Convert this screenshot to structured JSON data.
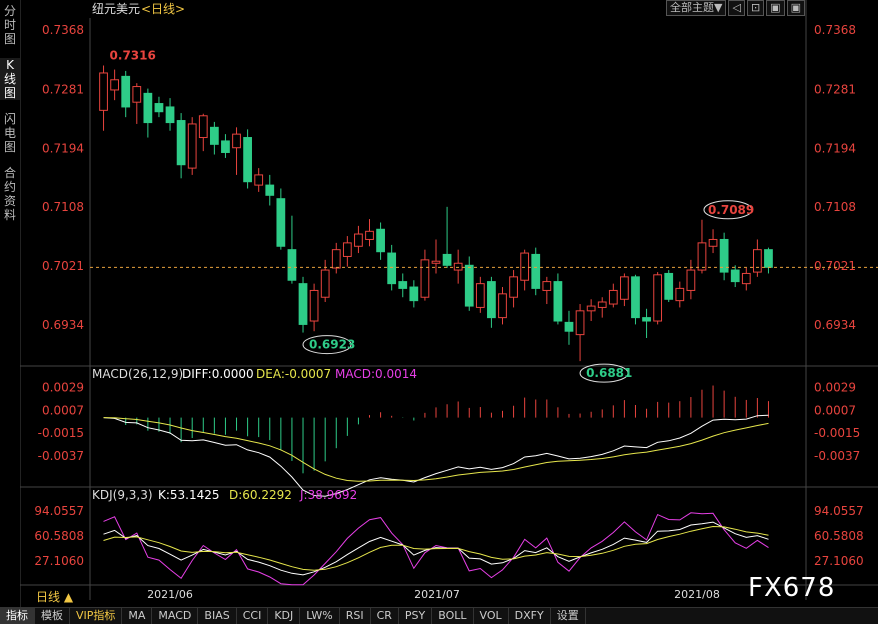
{
  "left_tabs": [
    {
      "label": "分时图",
      "active": false
    },
    {
      "label": "K线图",
      "active": true
    },
    {
      "label": "闪电图",
      "active": false
    },
    {
      "label": "合约资料",
      "active": false
    }
  ],
  "header": {
    "symbol": "纽元美元",
    "period_tag": "<日线>"
  },
  "top_controls": {
    "theme_label": "全部主题▼",
    "buttons": [
      "◁",
      "⊡",
      "▣",
      "▣"
    ]
  },
  "colors": {
    "up": "#e8443e",
    "down": "#2ecc88",
    "axis_text": "#e8443e",
    "grid": "#333",
    "white_line": "#ffffff",
    "yellow_line": "#e6e64c",
    "magenta_line": "#e63fe6"
  },
  "chart_data": [
    {
      "type": "candlestick",
      "title": "纽元美元<日线>",
      "y_ticks": [
        "0.7368",
        "0.7281",
        "0.7194",
        "0.7108",
        "0.7021",
        "0.6934"
      ],
      "ylim": [
        0.689,
        0.738
      ],
      "current_price": 0.7019,
      "annotations": [
        {
          "text": "0.7316",
          "value": 0.7316
        },
        {
          "text": "0.6923",
          "value": 0.6923
        },
        {
          "text": "0.6881",
          "value": 0.6881
        },
        {
          "text": "0.7089",
          "value": 0.7089
        }
      ],
      "x_labels": [
        "2021/06",
        "2021/07",
        "2021/08"
      ],
      "candles": [
        {
          "o": 0.725,
          "h": 0.7316,
          "l": 0.722,
          "c": 0.7305
        },
        {
          "o": 0.728,
          "h": 0.731,
          "l": 0.7265,
          "c": 0.7295
        },
        {
          "o": 0.73,
          "h": 0.7308,
          "l": 0.724,
          "c": 0.7255
        },
        {
          "o": 0.7262,
          "h": 0.729,
          "l": 0.723,
          "c": 0.7285
        },
        {
          "o": 0.7275,
          "h": 0.7282,
          "l": 0.721,
          "c": 0.7232
        },
        {
          "o": 0.726,
          "h": 0.727,
          "l": 0.724,
          "c": 0.7248
        },
        {
          "o": 0.7255,
          "h": 0.7268,
          "l": 0.722,
          "c": 0.7232
        },
        {
          "o": 0.7235,
          "h": 0.7246,
          "l": 0.715,
          "c": 0.717
        },
        {
          "o": 0.7165,
          "h": 0.724,
          "l": 0.7155,
          "c": 0.723
        },
        {
          "o": 0.721,
          "h": 0.7245,
          "l": 0.719,
          "c": 0.7242
        },
        {
          "o": 0.7225,
          "h": 0.7233,
          "l": 0.7185,
          "c": 0.72
        },
        {
          "o": 0.7205,
          "h": 0.7215,
          "l": 0.718,
          "c": 0.7188
        },
        {
          "o": 0.7195,
          "h": 0.7225,
          "l": 0.7155,
          "c": 0.7215
        },
        {
          "o": 0.721,
          "h": 0.7222,
          "l": 0.7135,
          "c": 0.7145
        },
        {
          "o": 0.714,
          "h": 0.7165,
          "l": 0.713,
          "c": 0.7155
        },
        {
          "o": 0.714,
          "h": 0.7155,
          "l": 0.711,
          "c": 0.7125
        },
        {
          "o": 0.712,
          "h": 0.7135,
          "l": 0.7045,
          "c": 0.705
        },
        {
          "o": 0.7045,
          "h": 0.7095,
          "l": 0.6995,
          "c": 0.7
        },
        {
          "o": 0.6995,
          "h": 0.7005,
          "l": 0.6923,
          "c": 0.6935
        },
        {
          "o": 0.694,
          "h": 0.6995,
          "l": 0.6925,
          "c": 0.6985
        },
        {
          "o": 0.6975,
          "h": 0.703,
          "l": 0.6968,
          "c": 0.7015
        },
        {
          "o": 0.7018,
          "h": 0.7055,
          "l": 0.701,
          "c": 0.7045
        },
        {
          "o": 0.7035,
          "h": 0.7065,
          "l": 0.702,
          "c": 0.7055
        },
        {
          "o": 0.705,
          "h": 0.708,
          "l": 0.704,
          "c": 0.7068
        },
        {
          "o": 0.706,
          "h": 0.709,
          "l": 0.705,
          "c": 0.7072
        },
        {
          "o": 0.7075,
          "h": 0.7085,
          "l": 0.703,
          "c": 0.7042
        },
        {
          "o": 0.704,
          "h": 0.7052,
          "l": 0.6985,
          "c": 0.6995
        },
        {
          "o": 0.6998,
          "h": 0.701,
          "l": 0.6975,
          "c": 0.6988
        },
        {
          "o": 0.699,
          "h": 0.7,
          "l": 0.696,
          "c": 0.697
        },
        {
          "o": 0.6975,
          "h": 0.7045,
          "l": 0.697,
          "c": 0.703
        },
        {
          "o": 0.7025,
          "h": 0.706,
          "l": 0.701,
          "c": 0.7028
        },
        {
          "o": 0.7038,
          "h": 0.7108,
          "l": 0.7018,
          "c": 0.7022
        },
        {
          "o": 0.7015,
          "h": 0.7045,
          "l": 0.6995,
          "c": 0.7025
        },
        {
          "o": 0.7022,
          "h": 0.7035,
          "l": 0.6955,
          "c": 0.6962
        },
        {
          "o": 0.696,
          "h": 0.7005,
          "l": 0.6952,
          "c": 0.6995
        },
        {
          "o": 0.6998,
          "h": 0.7005,
          "l": 0.693,
          "c": 0.6945
        },
        {
          "o": 0.6945,
          "h": 0.699,
          "l": 0.6935,
          "c": 0.698
        },
        {
          "o": 0.6975,
          "h": 0.7015,
          "l": 0.696,
          "c": 0.7005
        },
        {
          "o": 0.7,
          "h": 0.7045,
          "l": 0.6985,
          "c": 0.704
        },
        {
          "o": 0.7038,
          "h": 0.7048,
          "l": 0.6978,
          "c": 0.6988
        },
        {
          "o": 0.6985,
          "h": 0.7005,
          "l": 0.6965,
          "c": 0.6998
        },
        {
          "o": 0.6998,
          "h": 0.701,
          "l": 0.6935,
          "c": 0.694
        },
        {
          "o": 0.6938,
          "h": 0.6955,
          "l": 0.6905,
          "c": 0.6925
        },
        {
          "o": 0.692,
          "h": 0.6965,
          "l": 0.6881,
          "c": 0.6955
        },
        {
          "o": 0.6955,
          "h": 0.6972,
          "l": 0.694,
          "c": 0.6962
        },
        {
          "o": 0.696,
          "h": 0.6975,
          "l": 0.6945,
          "c": 0.6968
        },
        {
          "o": 0.6965,
          "h": 0.6995,
          "l": 0.696,
          "c": 0.6985
        },
        {
          "o": 0.6972,
          "h": 0.701,
          "l": 0.6962,
          "c": 0.7005
        },
        {
          "o": 0.7005,
          "h": 0.7008,
          "l": 0.6935,
          "c": 0.6945
        },
        {
          "o": 0.6945,
          "h": 0.6958,
          "l": 0.6915,
          "c": 0.694
        },
        {
          "o": 0.694,
          "h": 0.7012,
          "l": 0.6935,
          "c": 0.7008
        },
        {
          "o": 0.701,
          "h": 0.7015,
          "l": 0.6968,
          "c": 0.6972
        },
        {
          "o": 0.697,
          "h": 0.6998,
          "l": 0.696,
          "c": 0.6988
        },
        {
          "o": 0.6985,
          "h": 0.703,
          "l": 0.6972,
          "c": 0.7015
        },
        {
          "o": 0.7015,
          "h": 0.7089,
          "l": 0.701,
          "c": 0.7055
        },
        {
          "o": 0.705,
          "h": 0.7075,
          "l": 0.704,
          "c": 0.706
        },
        {
          "o": 0.706,
          "h": 0.707,
          "l": 0.7,
          "c": 0.7012
        },
        {
          "o": 0.7015,
          "h": 0.7022,
          "l": 0.699,
          "c": 0.6998
        },
        {
          "o": 0.6995,
          "h": 0.7018,
          "l": 0.6985,
          "c": 0.701
        },
        {
          "o": 0.7012,
          "h": 0.706,
          "l": 0.7005,
          "c": 0.7045
        },
        {
          "o": 0.7045,
          "h": 0.7048,
          "l": 0.701,
          "c": 0.7019
        }
      ]
    },
    {
      "type": "macd",
      "label": "MACD(26,12,9)",
      "values_text": {
        "diff": "DIFF:0.0000",
        "dea": "DEA:-0.0007",
        "macd": "MACD:0.0014"
      },
      "y_ticks": [
        "0.0029",
        "0.0007",
        "-0.0015",
        "-0.0037"
      ],
      "ylim": [
        -0.006,
        0.004
      ]
    },
    {
      "type": "kdj",
      "label": "KDJ(9,3,3)",
      "values_text": {
        "k": "K:53.1425",
        "d": "D:60.2292",
        "j": "J:38.9692"
      },
      "y_ticks": [
        "94.0557",
        "60.5808",
        "27.1060"
      ],
      "ylim": [
        0,
        110
      ]
    }
  ],
  "bottom_tabs": [
    {
      "label": "指标",
      "active": true,
      "vip": false
    },
    {
      "label": "模板",
      "active": false,
      "vip": false
    },
    {
      "label": "VIP指标",
      "active": false,
      "vip": true
    },
    {
      "label": "MA",
      "active": false,
      "vip": false
    },
    {
      "label": "MACD",
      "active": false,
      "vip": false
    },
    {
      "label": "BIAS",
      "active": false,
      "vip": false
    },
    {
      "label": "CCI",
      "active": false,
      "vip": false
    },
    {
      "label": "KDJ",
      "active": false,
      "vip": false
    },
    {
      "label": "LW%",
      "active": false,
      "vip": false
    },
    {
      "label": "RSI",
      "active": false,
      "vip": false
    },
    {
      "label": "CR",
      "active": false,
      "vip": false
    },
    {
      "label": "PSY",
      "active": false,
      "vip": false
    },
    {
      "label": "BOLL",
      "active": false,
      "vip": false
    },
    {
      "label": "VOL",
      "active": false,
      "vip": false
    },
    {
      "label": "DXFY",
      "active": false,
      "vip": false
    },
    {
      "label": "设置",
      "active": false,
      "vip": false
    }
  ],
  "period_label": "日线 ▲",
  "watermark": "FX678"
}
